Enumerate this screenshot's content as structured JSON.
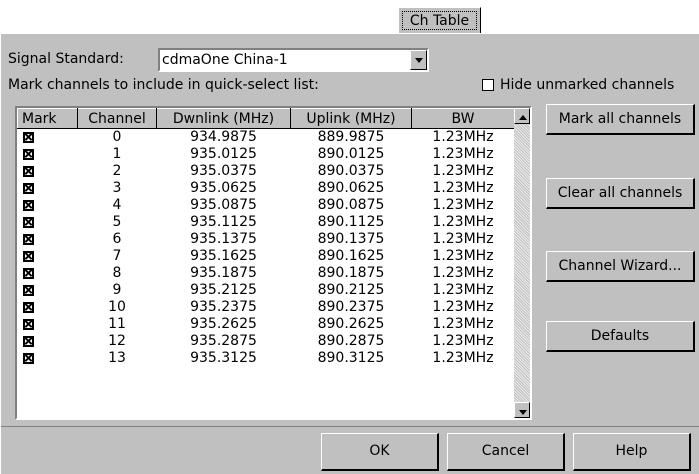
{
  "tab": {
    "label": "Ch Table"
  },
  "signal": {
    "label": "Signal Standard:",
    "value": "cdmaOne China-1"
  },
  "instruction": "Mark channels to include in quick-select list:",
  "hide_unmarked": {
    "label": "Hide unmarked channels",
    "checked": false
  },
  "table": {
    "columns": [
      "Mark",
      "Channel",
      "Dwnlink (MHz)",
      "Uplink (MHz)",
      "BW"
    ],
    "rows": [
      {
        "mark": true,
        "channel": "0",
        "dl": "934.9875",
        "ul": "889.9875",
        "bw": "1.23MHz"
      },
      {
        "mark": true,
        "channel": "1",
        "dl": "935.0125",
        "ul": "890.0125",
        "bw": "1.23MHz"
      },
      {
        "mark": true,
        "channel": "2",
        "dl": "935.0375",
        "ul": "890.0375",
        "bw": "1.23MHz"
      },
      {
        "mark": true,
        "channel": "3",
        "dl": "935.0625",
        "ul": "890.0625",
        "bw": "1.23MHz"
      },
      {
        "mark": true,
        "channel": "4",
        "dl": "935.0875",
        "ul": "890.0875",
        "bw": "1.23MHz"
      },
      {
        "mark": true,
        "channel": "5",
        "dl": "935.1125",
        "ul": "890.1125",
        "bw": "1.23MHz"
      },
      {
        "mark": true,
        "channel": "6",
        "dl": "935.1375",
        "ul": "890.1375",
        "bw": "1.23MHz"
      },
      {
        "mark": true,
        "channel": "7",
        "dl": "935.1625",
        "ul": "890.1625",
        "bw": "1.23MHz"
      },
      {
        "mark": true,
        "channel": "8",
        "dl": "935.1875",
        "ul": "890.1875",
        "bw": "1.23MHz"
      },
      {
        "mark": true,
        "channel": "9",
        "dl": "935.2125",
        "ul": "890.2125",
        "bw": "1.23MHz"
      },
      {
        "mark": true,
        "channel": "10",
        "dl": "935.2375",
        "ul": "890.2375",
        "bw": "1.23MHz"
      },
      {
        "mark": true,
        "channel": "11",
        "dl": "935.2625",
        "ul": "890.2625",
        "bw": "1.23MHz"
      },
      {
        "mark": true,
        "channel": "12",
        "dl": "935.2875",
        "ul": "890.2875",
        "bw": "1.23MHz"
      },
      {
        "mark": true,
        "channel": "13",
        "dl": "935.3125",
        "ul": "890.3125",
        "bw": "1.23MHz"
      }
    ]
  },
  "buttons": {
    "mark_all": "Mark all channels",
    "clear_all": "Clear all channels",
    "wizard": "Channel Wizard...",
    "defaults": "Defaults",
    "ok": "OK",
    "cancel": "Cancel",
    "help": "Help"
  }
}
